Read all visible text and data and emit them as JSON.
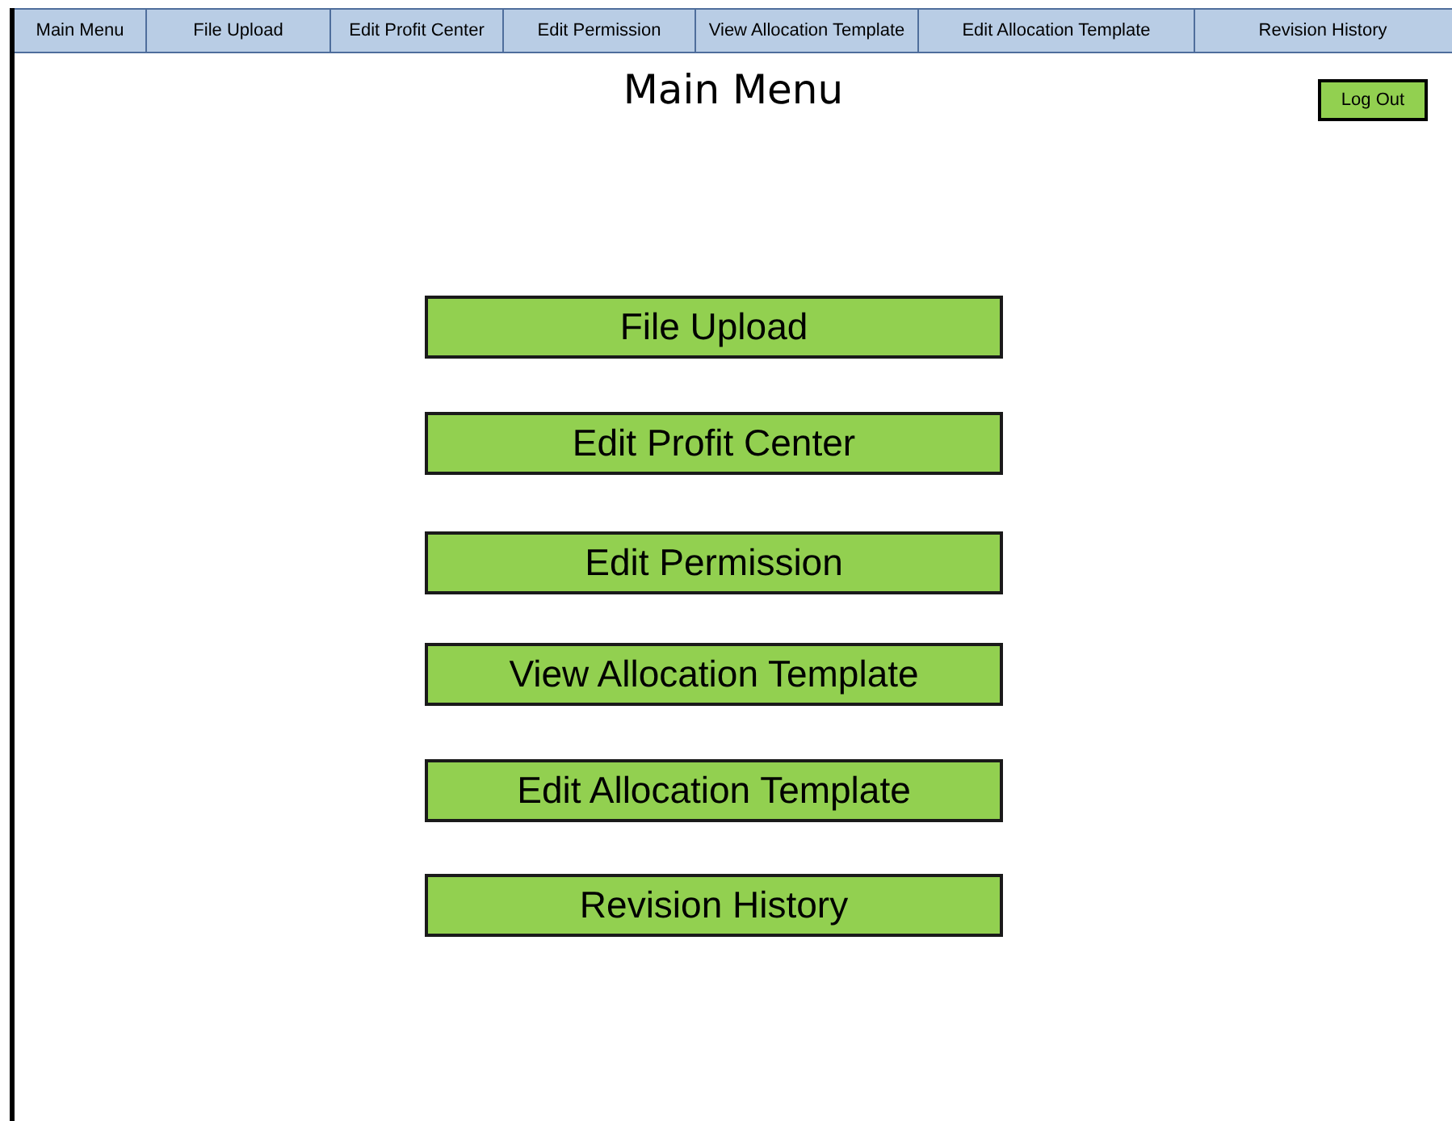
{
  "tabs": [
    {
      "label": "Main Menu"
    },
    {
      "label": "File Upload"
    },
    {
      "label": "Edit Profit Center"
    },
    {
      "label": "Edit Permission"
    },
    {
      "label": "View Allocation Template"
    },
    {
      "label": "Edit Allocation Template"
    },
    {
      "label": "Revision History"
    }
  ],
  "title": "Main Menu",
  "logout": "Log Out",
  "menu_buttons": [
    "File Upload",
    "Edit Profit Center",
    "Edit Permission",
    "View Allocation Template",
    "Edit Allocation Template",
    "Revision History"
  ]
}
